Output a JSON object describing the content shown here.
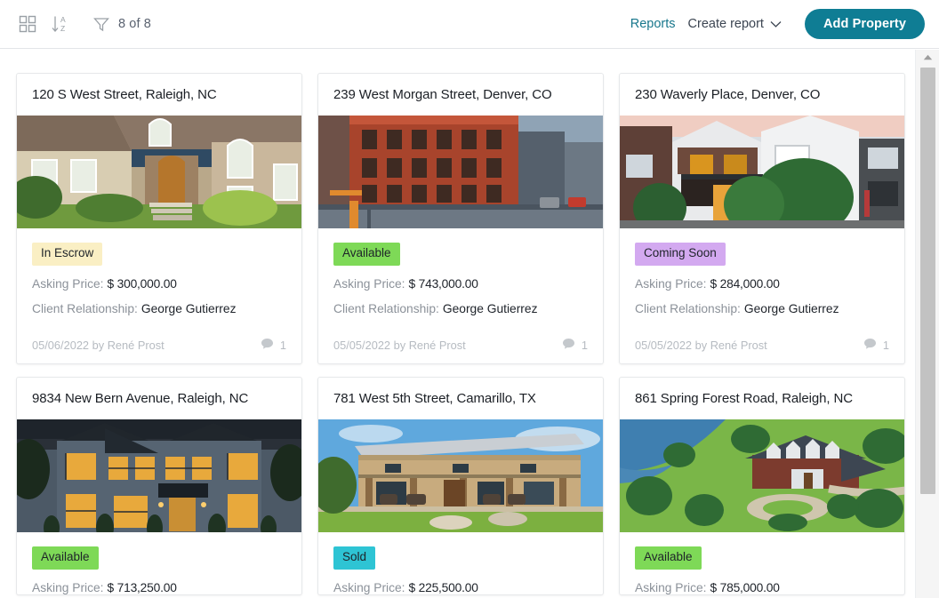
{
  "toolbar": {
    "grid_view_icon": "grid-view-icon",
    "sort_icon": "sort-az-icon",
    "filter_icon": "funnel-filter-icon",
    "count_text": "8 of 8",
    "reports_label": "Reports",
    "create_report_label": "Create report",
    "chevron_icon": "chevron-down-icon",
    "add_property_label": "Add Property"
  },
  "colors": {
    "accent_teal": "#0f7d94",
    "link_teal": "#18778c",
    "badge_in_escrow_bg": "#faefc4",
    "badge_available_bg": "#7ed957",
    "badge_coming_soon_bg": "#d3a9f0",
    "badge_sold_bg": "#2ec4d4",
    "text_dark": "#1b1f25",
    "text_muted": "#8b9199",
    "text_footer": "#b6bbc1"
  },
  "labels": {
    "asking_price": "Asking Price:",
    "client_relationship": "Client Relationship:",
    "comment_icon": "comment-bubble-icon"
  },
  "cards": [
    {
      "title": "120 S West Street, Raleigh, NC",
      "status": "In Escrow",
      "status_color": "#faefc4",
      "asking_price": "$ 300,000.00",
      "client": "George Gutierrez",
      "date": "05/06/2022",
      "author": "by René Prost",
      "comments": "1",
      "photo": "stone-brick-house-with-arched-door"
    },
    {
      "title": "239 West Morgan Street, Denver, CO",
      "status": "Available",
      "status_color": "#7ed957",
      "asking_price": "$ 743,000.00",
      "client": "George Gutierrez",
      "date": "05/05/2022",
      "author": "by René Prost",
      "comments": "1",
      "photo": "red-brick-apartment-building-street"
    },
    {
      "title": "230 Waverly Place, Denver, CO",
      "status": "Coming Soon",
      "status_color": "#d3a9f0",
      "asking_price": "$ 284,000.00",
      "client": "George Gutierrez",
      "date": "05/05/2022",
      "author": "by René Prost",
      "comments": "1",
      "photo": "modern-townhomes-at-dusk"
    },
    {
      "title": "9834 New Bern Avenue, Raleigh, NC",
      "status": "Available",
      "status_color": "#7ed957",
      "asking_price": "$ 713,250.00",
      "client": "",
      "date": "",
      "author": "",
      "comments": "",
      "photo": "grey-two-story-house-lit-windows-evening"
    },
    {
      "title": "781 West 5th Street, Camarillo, TX",
      "status": "Sold",
      "status_color": "#2ec4d4",
      "asking_price": "$ 225,500.00",
      "client": "",
      "date": "",
      "author": "",
      "comments": "",
      "photo": "stone-ranch-house-with-porch"
    },
    {
      "title": "861 Spring Forest Road, Raleigh, NC",
      "status": "Available",
      "status_color": "#7ed957",
      "asking_price": "$ 785,000.00",
      "client": "",
      "date": "",
      "author": "",
      "comments": "",
      "photo": "aerial-estate-by-lake-circular-driveway"
    }
  ]
}
